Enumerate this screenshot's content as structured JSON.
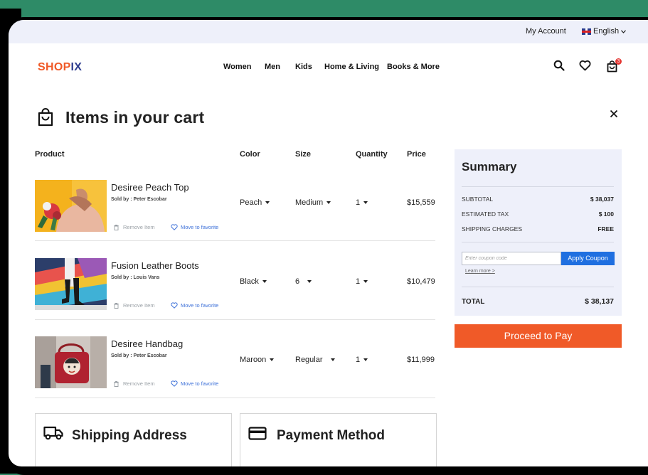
{
  "topbar": {
    "my_account": "My Account",
    "language": "English"
  },
  "logo": {
    "part1": "SHOP",
    "part2": "IX"
  },
  "nav": [
    "Women",
    "Men",
    "Kids",
    "Home & Living",
    "Books & More"
  ],
  "header_icons": {
    "search": "search-icon",
    "wishlist": "heart-icon",
    "cart": "cart-bag-icon",
    "cart_count": "3"
  },
  "cart": {
    "title": "Items in your cart",
    "close": "close-icon"
  },
  "table": {
    "headers": {
      "product": "Product",
      "color": "Color",
      "size": "Size",
      "quantity": "Quantity",
      "price": "Price"
    },
    "remove_label": "Remove Item",
    "favorite_label": "Move to favorite",
    "items": [
      {
        "name": "Desiree Peach Top",
        "seller": "Sold by : Peter Escobar",
        "color": "Peach",
        "size": "Medium",
        "quantity": "1",
        "price": "$15,559"
      },
      {
        "name": "Fusion Leather Boots",
        "seller": "Sold by : Louis Vans",
        "color": "Black",
        "size": "6",
        "quantity": "1",
        "price": "$10,479"
      },
      {
        "name": "Desiree Handbag",
        "seller": "Sold by : Peter Escobar",
        "color": "Maroon",
        "size": "Regular",
        "quantity": "1",
        "price": "$11,999"
      }
    ]
  },
  "summary": {
    "title": "Summary",
    "subtotal_label": "SUBTOTAL",
    "subtotal_value": "$ 38,037",
    "tax_label": "ESTIMATED TAX",
    "tax_value": "$ 100",
    "shipping_label": "SHIPPING CHARGES",
    "shipping_value": "FREE",
    "coupon_placeholder": "Enter coupon code",
    "coupon_button": "Apply Coupon",
    "learn_more": "Learn more >",
    "total_label": "TOTAL",
    "total_value": "$ 38,137"
  },
  "proceed_button": "Proceed to Pay",
  "sections": {
    "shipping": "Shipping Address",
    "payment": "Payment Method"
  },
  "colors": {
    "brand_orange": "#f05a28",
    "brand_blue": "#2d3c8e",
    "accent_blue": "#1f6fe0",
    "summary_bg": "#eef0fa"
  }
}
